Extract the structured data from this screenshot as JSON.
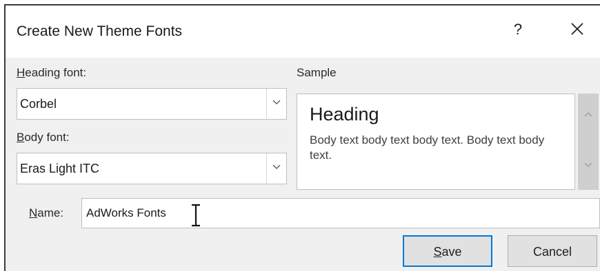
{
  "dialog": {
    "title": "Create New Theme Fonts",
    "help_label": "?"
  },
  "heading_font": {
    "label_accel": "H",
    "label_rest": "eading font:",
    "value": "Corbel"
  },
  "body_font": {
    "label_accel": "B",
    "label_rest": "ody font:",
    "value": "Eras Light ITC"
  },
  "sample": {
    "label": "Sample",
    "heading": "Heading",
    "body": "Body text body text body text. Body text body text."
  },
  "name": {
    "label_accel": "N",
    "label_rest": "ame:",
    "value": "AdWorks Fonts"
  },
  "buttons": {
    "save_accel": "S",
    "save_rest": "ave",
    "cancel": "Cancel"
  },
  "colors": {
    "default_button_border": "#0078d7",
    "dialog_background": "#f0f0f0"
  },
  "icons": [
    "close-icon",
    "chevron-down-icon",
    "chevron-up-icon",
    "text-cursor-icon"
  ]
}
